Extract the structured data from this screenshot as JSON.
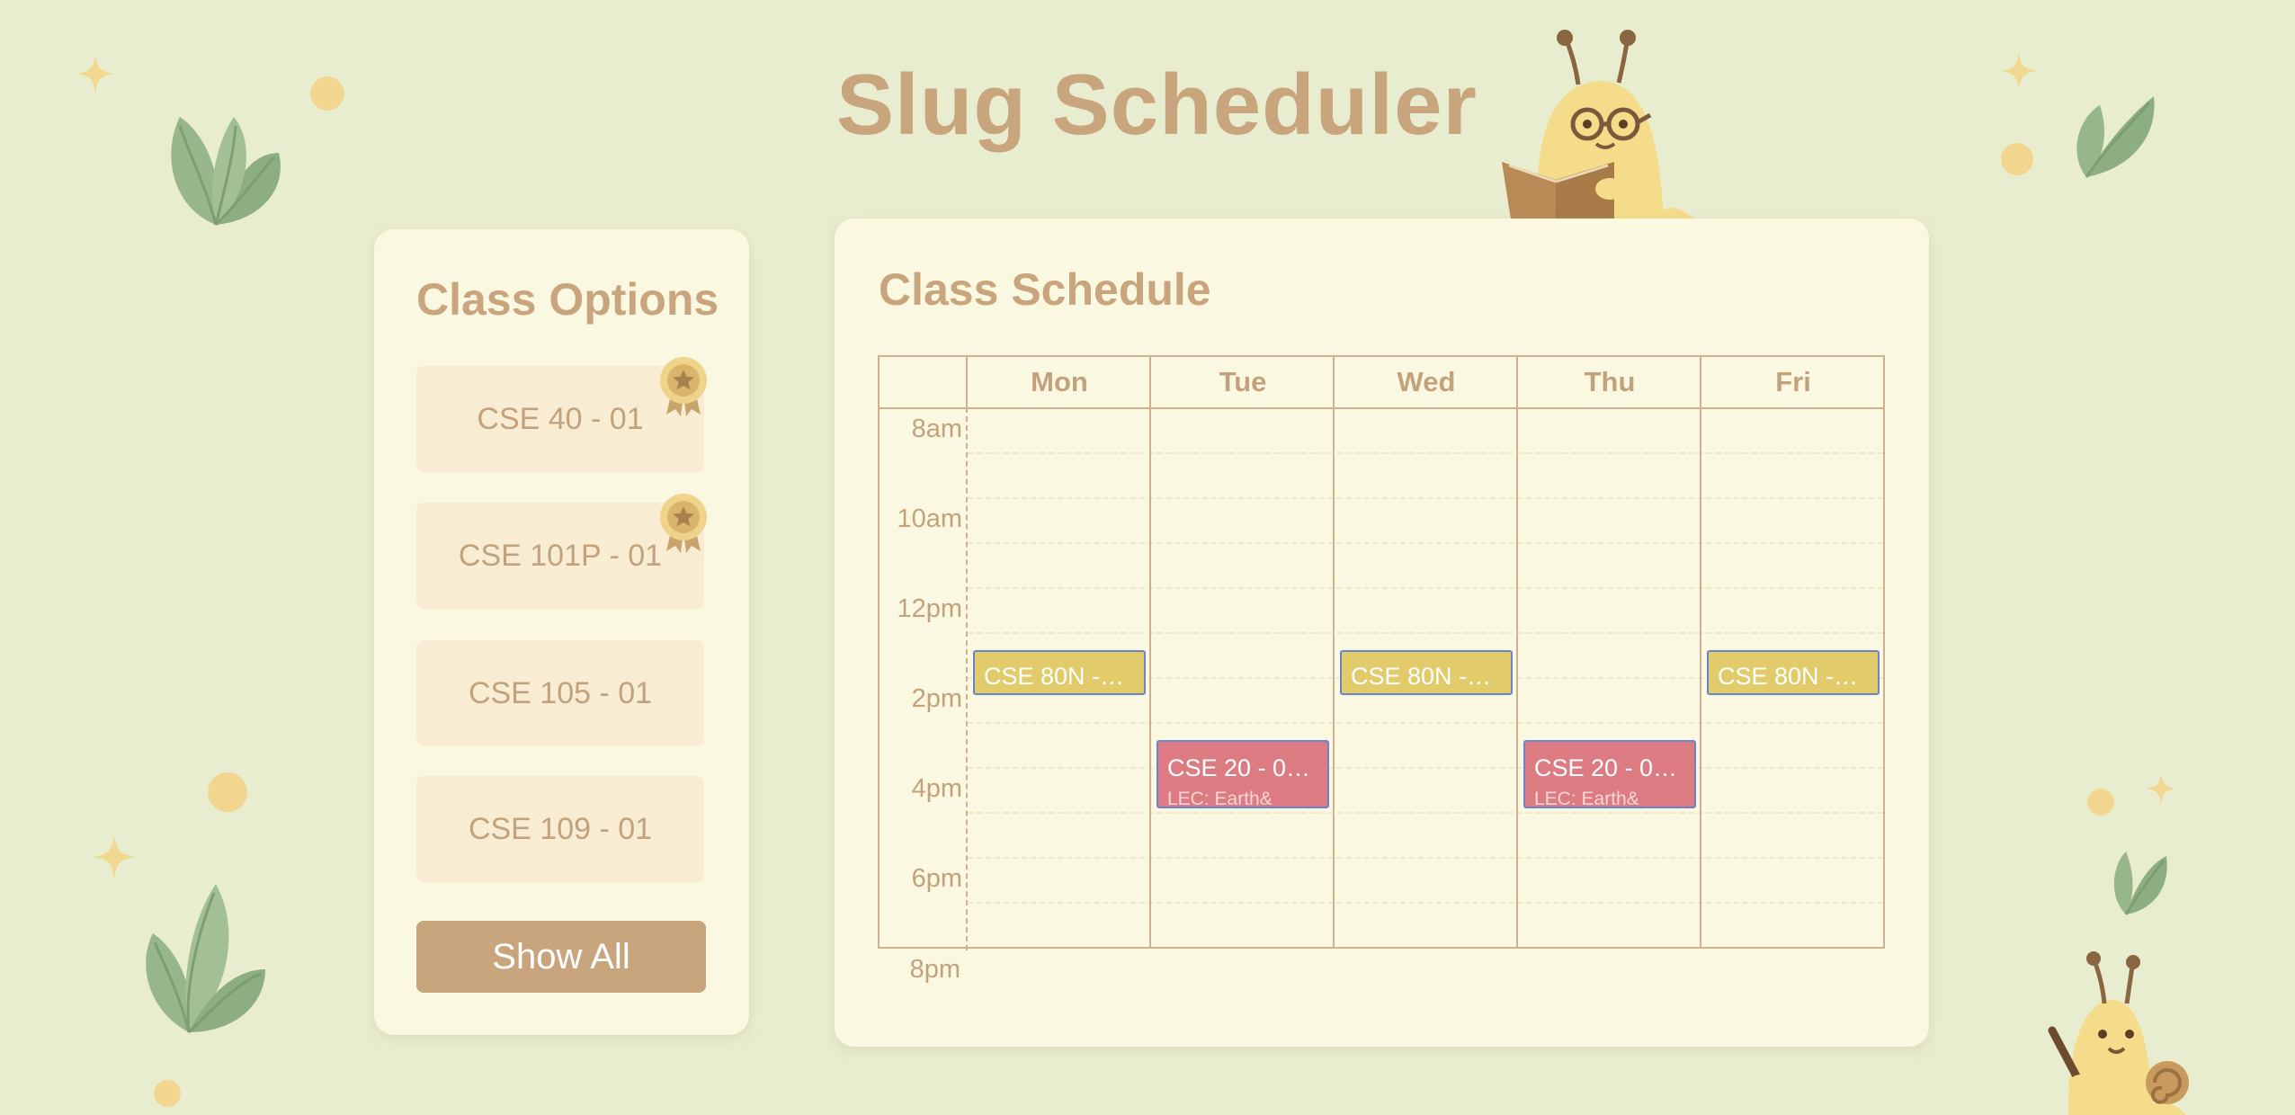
{
  "app": {
    "title": "Slug Scheduler"
  },
  "options_panel": {
    "heading": "Class Options",
    "classes": [
      {
        "label": "CSE 40 - 01",
        "badge": true
      },
      {
        "label": "CSE 101P - 01",
        "badge": true
      },
      {
        "label": "CSE 105 - 01",
        "badge": false
      },
      {
        "label": "CSE 109 - 01",
        "badge": false
      }
    ],
    "show_all_label": "Show All"
  },
  "schedule_panel": {
    "heading": "Class Schedule",
    "days": [
      "Mon",
      "Tue",
      "Wed",
      "Thu",
      "Fri"
    ],
    "time_labels": [
      "8am",
      "10am",
      "12pm",
      "2pm",
      "4pm",
      "6pm",
      "8pm"
    ],
    "courses": [
      {
        "title": "CSE 80N -…",
        "day": "Mon",
        "color": "#e1cb6a"
      },
      {
        "title": "CSE 80N -…",
        "day": "Wed",
        "color": "#e1cb6a"
      },
      {
        "title": "CSE 80N -…",
        "day": "Fri",
        "color": "#e1cb6a"
      },
      {
        "title": "CSE 20 - 0…",
        "subtitle": "LEC: Earth&",
        "day": "Tue",
        "color": "#dd7b83"
      },
      {
        "title": "CSE 20 - 0…",
        "subtitle": "LEC: Earth&",
        "day": "Thu",
        "color": "#dd7b83"
      }
    ]
  },
  "colors": {
    "background": "#e9edcf",
    "panel": "#fbf8e2",
    "accent": "#c8a57d",
    "card": "#f8edd3"
  },
  "icons": [
    "sparkle-icon",
    "leaf-icon",
    "dot-icon",
    "badge-icon",
    "slug-reading-illustration",
    "slug-writing-illustration"
  ]
}
